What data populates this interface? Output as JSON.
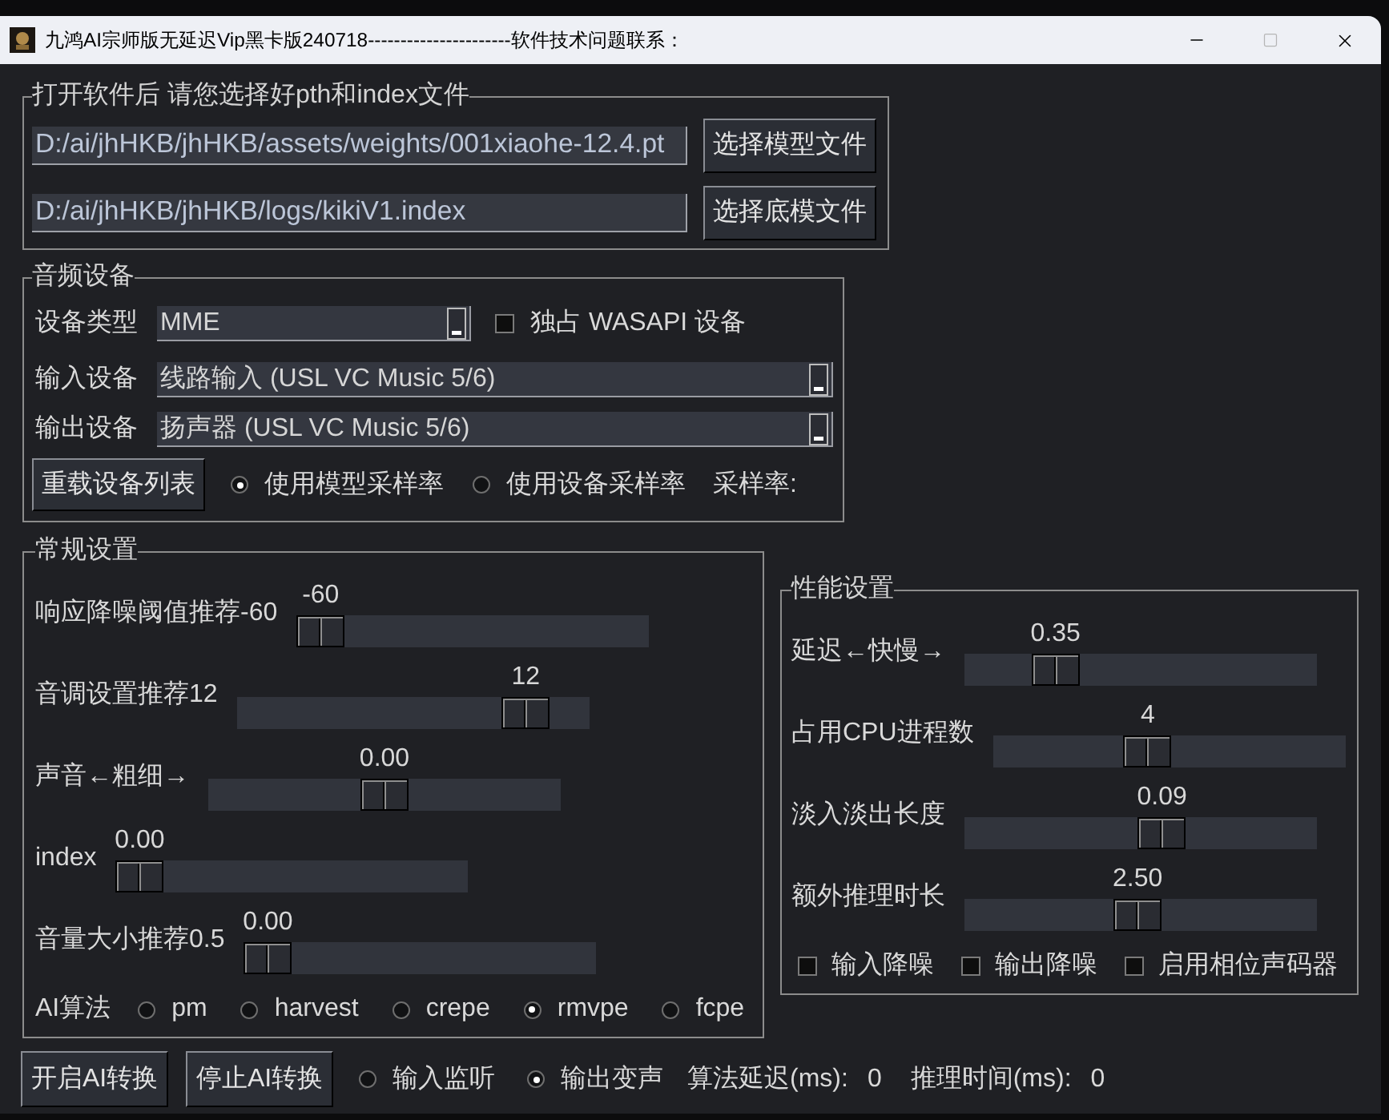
{
  "window": {
    "title": "九鸿AI宗师版无延迟Vip黑卡版240718----------------------软件技术问题联系："
  },
  "model_files": {
    "title": "打开软件后 请您选择好pth和index文件",
    "rows": [
      {
        "path": "D:/ai/jhHKB/jhHKB/assets/weights/001xiaohe-12.4.pt",
        "button": "选择模型文件"
      },
      {
        "path": "D:/ai/jhHKB/jhHKB/logs/kikiV1.index",
        "button": "选择底模文件"
      }
    ]
  },
  "audio_devices": {
    "title": "音频设备",
    "device_type": {
      "label": "设备类型",
      "value": "MME"
    },
    "exclusive_wasapi": {
      "label": "独占 WASAPI 设备",
      "checked": false
    },
    "input_device": {
      "label": "输入设备",
      "value": "线路输入 (USL VC Music 5/6)"
    },
    "output_device": {
      "label": "输出设备",
      "value": "扬声器 (USL VC Music 5/6)"
    },
    "reload_button": "重载设备列表",
    "sample_rate_modes": [
      {
        "label": "使用模型采样率",
        "selected": true
      },
      {
        "label": "使用设备采样率",
        "selected": false
      }
    ],
    "sample_rate_label": "采样率:"
  },
  "general_settings": {
    "title": "常规设置",
    "sliders": [
      {
        "label": "响应降噪阈值推荐-60",
        "reading": "-60",
        "level": 0
      },
      {
        "label": "音调设置推荐12",
        "reading": "12",
        "level": 0.87
      },
      {
        "label": "声音←粗细→",
        "reading": "0.00",
        "level": 0.5
      },
      {
        "label": "index",
        "reading": "0.00",
        "level": 0
      },
      {
        "label": "音量大小推荐0.5",
        "reading": "0.00",
        "level": 0
      }
    ],
    "algorithm": {
      "label": "AI算法",
      "options": [
        {
          "label": "pm",
          "selected": false
        },
        {
          "label": "harvest",
          "selected": false
        },
        {
          "label": "crepe",
          "selected": false
        },
        {
          "label": "rmvpe",
          "selected": true
        },
        {
          "label": "fcpe",
          "selected": false
        }
      ]
    }
  },
  "performance_settings": {
    "title": "性能设置",
    "sliders": [
      {
        "label": "延迟←快慢→",
        "reading": "0.35",
        "level": 0.22
      },
      {
        "label": "占用CPU进程数",
        "reading": "4",
        "level": 0.43
      },
      {
        "label": "淡入淡出长度",
        "reading": "0.09",
        "level": 0.57
      },
      {
        "label": "额外推理时长",
        "reading": "2.50",
        "level": 0.49
      }
    ],
    "options": [
      {
        "label": "输入降噪",
        "checked": false
      },
      {
        "label": "输出降噪",
        "checked": false
      },
      {
        "label": "启用相位声码器",
        "checked": false
      }
    ]
  },
  "bottom_bar": {
    "buttons": [
      "开启AI转换",
      "停止AI转换"
    ],
    "monitor_modes": [
      {
        "label": "输入监听",
        "selected": false
      },
      {
        "label": "输出变声",
        "selected": true
      }
    ],
    "stats": [
      {
        "label": "算法延迟(ms):",
        "value": "0"
      },
      {
        "label": "推理时间(ms):",
        "value": "0"
      }
    ]
  }
}
